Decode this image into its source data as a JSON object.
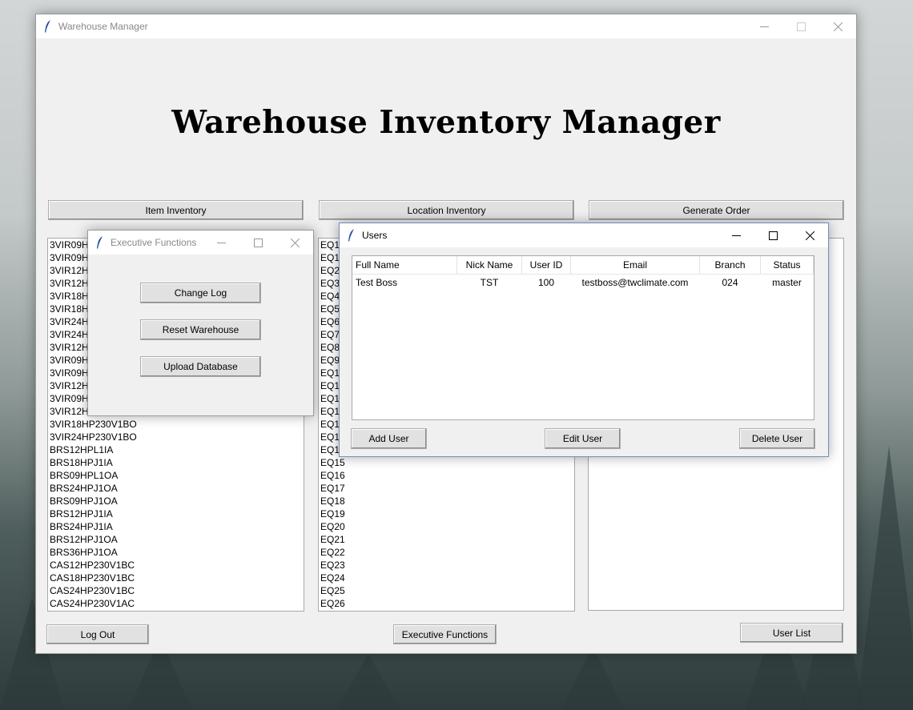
{
  "main_window": {
    "title": "Warehouse Manager",
    "heading": "Warehouse Inventory Manager",
    "buttons": {
      "item_inventory": "Item Inventory",
      "location_inventory": "Location Inventory",
      "generate_order": "Generate Order",
      "log_out": "Log Out",
      "executive_functions": "Executive Functions",
      "user_list": "User List"
    },
    "items": [
      "3VIR09HP",
      "3VIR09HP",
      "3VIR12HP",
      "3VIR12HP",
      "3VIR18HP",
      "3VIR18HP",
      "3VIR24HP",
      "3VIR24HP",
      "3VIR12HP",
      "3VIR09HP",
      "3VIR09HP",
      "3VIR12HP",
      "3VIR09HP",
      "3VIR12HP",
      "3VIR18HP230V1BO",
      "3VIR24HP230V1BO",
      "BRS12HPL1IA",
      "BRS18HPJ1IA",
      "BRS09HPL1OA",
      "BRS24HPJ1OA",
      "BRS09HPJ1OA",
      "BRS12HPJ1IA",
      "BRS24HPJ1IA",
      "BRS12HPJ1OA",
      "BRS36HPJ1OA",
      "CAS12HP230V1BC",
      "CAS18HP230V1BC",
      "CAS24HP230V1BC",
      "CAS24HP230V1AC"
    ],
    "locations": [
      "EQ1",
      "EQ1A",
      "EQ2",
      "EQ3",
      "EQ4",
      "EQ5",
      "EQ6",
      "EQ7",
      "EQ8",
      "EQ9",
      "EQ10",
      "EQ11",
      "EQ12",
      "EQ12",
      "EQ13",
      "EQ13",
      "EQ14",
      "EQ15",
      "EQ16",
      "EQ17",
      "EQ18",
      "EQ19",
      "EQ20",
      "EQ21",
      "EQ22",
      "EQ23",
      "EQ24",
      "EQ25",
      "EQ26"
    ]
  },
  "exec_window": {
    "title": "Executive Functions",
    "buttons": {
      "change_log": "Change Log",
      "reset_warehouse": "Reset Warehouse",
      "upload_database": "Upload Database"
    }
  },
  "users_window": {
    "title": "Users",
    "columns": {
      "full_name": "Full Name",
      "nick_name": "Nick Name",
      "user_id": "User ID",
      "email": "Email",
      "branch": "Branch",
      "status": "Status"
    },
    "rows": [
      {
        "full_name": "Test Boss",
        "nick_name": "TST",
        "user_id": "100",
        "email": "testboss@twclimate.com",
        "branch": "024",
        "status": "master"
      }
    ],
    "buttons": {
      "add_user": "Add User",
      "edit_user": "Edit User",
      "delete_user": "Delete User"
    }
  },
  "icons": {
    "app": "feather-icon",
    "minimize": "minimize-icon",
    "maximize": "maximize-icon",
    "close": "close-icon"
  }
}
